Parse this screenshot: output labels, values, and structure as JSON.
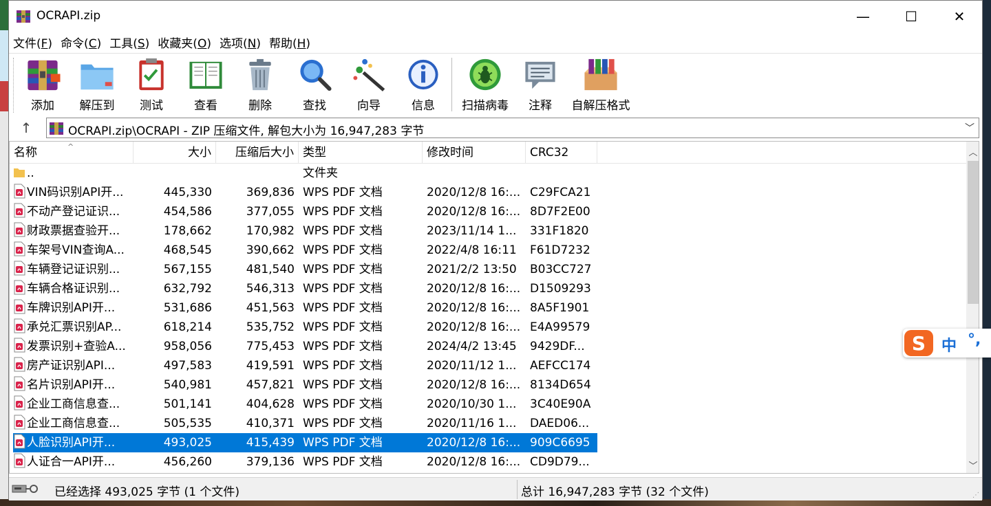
{
  "window": {
    "title": "OCRAPI.zip",
    "minimize": "—",
    "maximize": "☐",
    "close": "✕"
  },
  "menu": [
    {
      "label": "文件(",
      "key": "F",
      "end": ")"
    },
    {
      "label": "命令(",
      "key": "C",
      "end": ")"
    },
    {
      "label": "工具(",
      "key": "S",
      "end": ")"
    },
    {
      "label": "收藏夹(",
      "key": "O",
      "end": ")"
    },
    {
      "label": "选项(",
      "key": "N",
      "end": ")"
    },
    {
      "label": "帮助(",
      "key": "H",
      "end": ")"
    }
  ],
  "toolbar": {
    "add": "添加",
    "extract": "解压到",
    "test": "测试",
    "view": "查看",
    "delete": "删除",
    "find": "查找",
    "wizard": "向导",
    "info": "信息",
    "scan": "扫描病毒",
    "comment": "注释",
    "sfx": "自解压格式"
  },
  "address": {
    "up": "↑",
    "path": "OCRAPI.zip\\OCRAPI - ZIP 压缩文件, 解包大小为 16,947,283 字节",
    "dropdown": "﹀"
  },
  "columns": {
    "name": "名称",
    "size": "大小",
    "packed": "压缩后大小",
    "type": "类型",
    "modified": "修改时间",
    "crc": "CRC32",
    "sort_arrow": "^"
  },
  "rows": [
    {
      "name": "..",
      "size": "",
      "packed": "",
      "type": "文件夹",
      "modified": "",
      "crc": "",
      "kind": "folder"
    },
    {
      "name": "VIN码识别API开...",
      "size": "445,330",
      "packed": "369,836",
      "type": "WPS PDF 文档",
      "modified": "2020/12/8 16:...",
      "crc": "C29FCA21",
      "kind": "pdf"
    },
    {
      "name": "不动产登记证识...",
      "size": "454,586",
      "packed": "377,055",
      "type": "WPS PDF 文档",
      "modified": "2020/12/8 16:...",
      "crc": "8D7F2E00",
      "kind": "pdf"
    },
    {
      "name": "财政票据查验开...",
      "size": "178,662",
      "packed": "170,982",
      "type": "WPS PDF 文档",
      "modified": "2023/11/14 1...",
      "crc": "331F1820",
      "kind": "pdf"
    },
    {
      "name": "车架号VIN查询A...",
      "size": "468,545",
      "packed": "390,662",
      "type": "WPS PDF 文档",
      "modified": "2022/4/8 16:11",
      "crc": "F61D7232",
      "kind": "pdf"
    },
    {
      "name": "车辆登记证识别...",
      "size": "567,155",
      "packed": "481,540",
      "type": "WPS PDF 文档",
      "modified": "2021/2/2 13:50",
      "crc": "B03CC727",
      "kind": "pdf"
    },
    {
      "name": "车辆合格证识别...",
      "size": "632,792",
      "packed": "546,313",
      "type": "WPS PDF 文档",
      "modified": "2020/12/8 16:...",
      "crc": "D1509293",
      "kind": "pdf"
    },
    {
      "name": "车牌识别API开...",
      "size": "531,686",
      "packed": "451,563",
      "type": "WPS PDF 文档",
      "modified": "2020/12/8 16:...",
      "crc": "8A5F1901",
      "kind": "pdf"
    },
    {
      "name": "承兑汇票识别AP...",
      "size": "618,214",
      "packed": "535,752",
      "type": "WPS PDF 文档",
      "modified": "2020/12/8 16:...",
      "crc": "E4A99579",
      "kind": "pdf"
    },
    {
      "name": "发票识别+查验A...",
      "size": "958,056",
      "packed": "775,453",
      "type": "WPS PDF 文档",
      "modified": "2024/4/2 13:45",
      "crc": "9429DF...",
      "kind": "pdf"
    },
    {
      "name": "房产证识别API...",
      "size": "497,583",
      "packed": "419,591",
      "type": "WPS PDF 文档",
      "modified": "2020/11/12 1...",
      "crc": "AEFCC174",
      "kind": "pdf"
    },
    {
      "name": "名片识别API开...",
      "size": "540,981",
      "packed": "457,821",
      "type": "WPS PDF 文档",
      "modified": "2020/12/8 16:...",
      "crc": "8134D654",
      "kind": "pdf"
    },
    {
      "name": "企业工商信息查...",
      "size": "501,141",
      "packed": "404,628",
      "type": "WPS PDF 文档",
      "modified": "2020/10/30 1...",
      "crc": "3C40E90A",
      "kind": "pdf"
    },
    {
      "name": "企业工商信息查...",
      "size": "505,535",
      "packed": "410,371",
      "type": "WPS PDF 文档",
      "modified": "2020/11/16 1...",
      "crc": "DAED06...",
      "kind": "pdf"
    },
    {
      "name": "人脸识别API开...",
      "size": "493,025",
      "packed": "415,439",
      "type": "WPS PDF 文档",
      "modified": "2020/12/8 16:...",
      "crc": "909C6695",
      "kind": "pdf",
      "selected": true
    },
    {
      "name": "人证合一API开...",
      "size": "456,260",
      "packed": "379,136",
      "type": "WPS PDF 文档",
      "modified": "2020/12/8 16:...",
      "crc": "CD9D79...",
      "kind": "pdf"
    }
  ],
  "scrollbar": {
    "up": "︿",
    "down": "﹀"
  },
  "status": {
    "left": "已经选择 493,025 字节 (1 个文件)",
    "right": "总计 16,947,283 字节 (32 个文件)",
    "grip": "⋰"
  },
  "ime": {
    "lang": "中",
    "punct": "°,"
  },
  "colors": {
    "selection": "#0078d7",
    "pdf_icon": "#d9234b",
    "folder": "#f2c14e"
  }
}
